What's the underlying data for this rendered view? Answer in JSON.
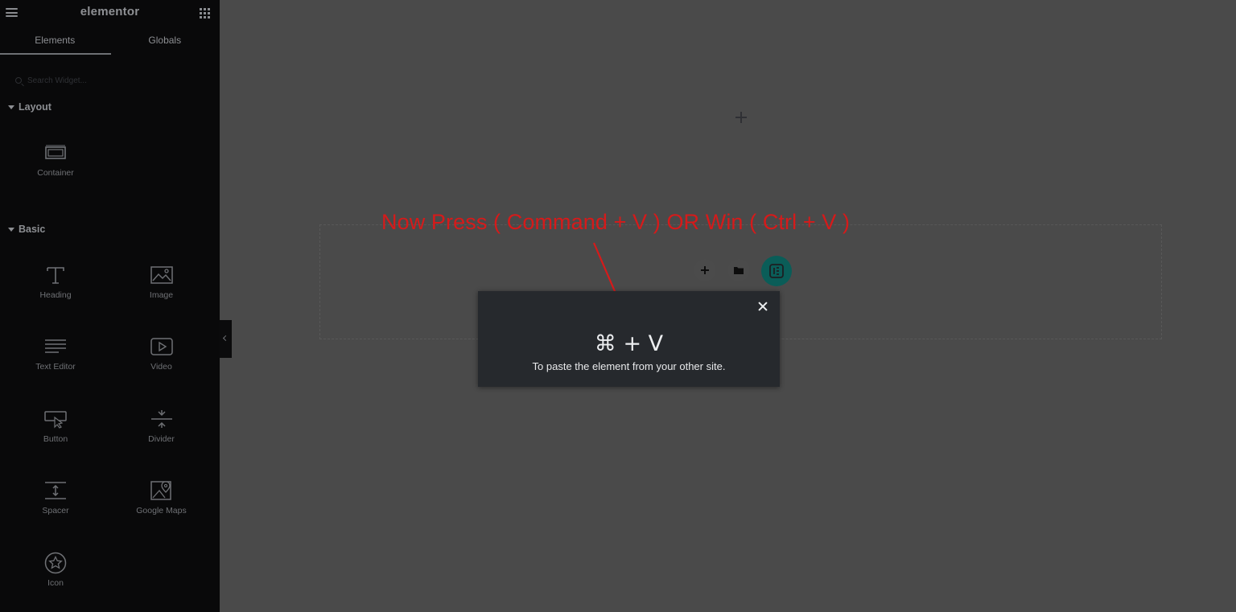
{
  "brand": {
    "logo_text": "elementor"
  },
  "panel": {
    "tabs": [
      {
        "label": "Elements",
        "active": true
      },
      {
        "label": "Globals",
        "active": false
      }
    ],
    "search": {
      "placeholder": "Search Widget..."
    },
    "sections": {
      "layout": {
        "title": "Layout",
        "widgets": [
          {
            "label": "Container",
            "icon": "container-icon"
          }
        ]
      },
      "basic": {
        "title": "Basic",
        "widgets": [
          {
            "label": "Heading",
            "icon": "heading-icon"
          },
          {
            "label": "Image",
            "icon": "image-icon"
          },
          {
            "label": "Text Editor",
            "icon": "text-editor-icon"
          },
          {
            "label": "Video",
            "icon": "video-icon"
          },
          {
            "label": "Button",
            "icon": "button-icon"
          },
          {
            "label": "Divider",
            "icon": "divider-icon"
          },
          {
            "label": "Spacer",
            "icon": "spacer-icon"
          },
          {
            "label": "Google Maps",
            "icon": "google-maps-icon"
          },
          {
            "label": "Icon",
            "icon": "star-icon"
          }
        ]
      }
    }
  },
  "canvas": {
    "annotation": "Now Press ( Command + V )  OR Win ( Ctrl + V )",
    "drop_zone_buttons": [
      "add-section",
      "add-template",
      "elementor-kit"
    ]
  },
  "dialog": {
    "shortcut": "⌘ + V",
    "message": "To paste the element from your other site."
  },
  "colors": {
    "sidebar_bg": "#09090a",
    "canvas_bg": "#4a4a4a",
    "dialog_bg": "#26292d",
    "annotation": "#d61a1a",
    "kit_button": "#0a5d58"
  }
}
